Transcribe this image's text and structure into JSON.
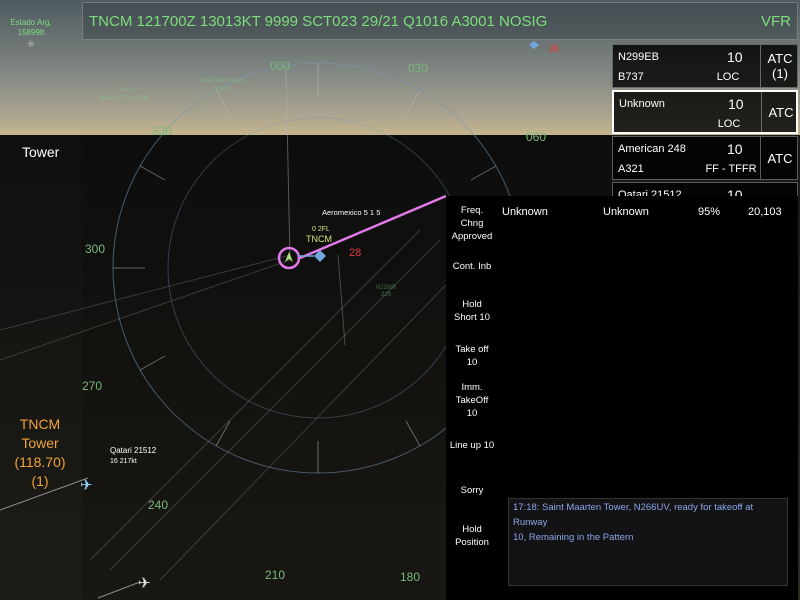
{
  "metar": {
    "text": "TNCM 121700Z 13013KT 9999 SCT023 29/21 Q1016 A3001 NOSIG",
    "rules": "VFR"
  },
  "top_left": {
    "label_line1": "Estado Arg.",
    "label_line2": "15899ft"
  },
  "left_panel": {
    "title": "Tower",
    "facility": {
      "name_line1": "TNCM",
      "name_line2": "Tower",
      "frequency": "(118.70)",
      "count": "(1)"
    }
  },
  "radar": {
    "headings": [
      "000",
      "030",
      "060",
      "300",
      "330",
      "270",
      "240",
      "210",
      "180"
    ],
    "center_label": "TNCM",
    "targets": [
      {
        "callsign": "Aeromexico 5 1 5",
        "info": "0 2FL"
      },
      {
        "callsign": "Qatari 21512",
        "info": "16 217kt"
      },
      {
        "callsign": "N239IR",
        "info": "22ft"
      },
      {
        "callsign": "GAM 848 Heavy",
        "info": "3000ft"
      },
      {
        "callsign": "Tripos",
        "info": "Boeing 777 2000ft"
      }
    ],
    "distance_marker": "28",
    "top_marker": "38"
  },
  "traffic_list": [
    {
      "name": "N299EB",
      "type": "B737",
      "altitude": "10",
      "mode": "LOC",
      "atc": "ATC",
      "atc_count": "(1)"
    },
    {
      "name": "Unknown",
      "type": "",
      "altitude": "10",
      "mode": "LOC",
      "atc": "ATC",
      "atc_count": ""
    },
    {
      "name": "American 248",
      "type": "A321",
      "altitude": "10",
      "mode": "FF - TFFR",
      "atc": "ATC",
      "atc_count": ""
    },
    {
      "name": "Qatari 21512",
      "type": "",
      "altitude": "10",
      "mode": "",
      "atc": "",
      "atc_count": ""
    }
  ],
  "commands": [
    {
      "line1": "Freq.",
      "line2": "Chng",
      "line3": "Approved"
    },
    {
      "line1": "Cont. Inb",
      "line2": "",
      "line3": ""
    },
    {
      "line1": "Hold",
      "line2": "Short 10",
      "line3": ""
    },
    {
      "line1": "Take off",
      "line2": "10",
      "line3": ""
    },
    {
      "line1": "Imm.",
      "line2": "TakeOff",
      "line3": "10"
    },
    {
      "line1": "Line up 10",
      "line2": "",
      "line3": ""
    },
    {
      "line1": "Sorry",
      "line2": "",
      "line3": ""
    },
    {
      "line1": "Hold",
      "line2": "Position",
      "line3": ""
    }
  ],
  "target_info": {
    "name": "Unknown",
    "type": "Unknown",
    "percent": "95%",
    "value": "20,103"
  },
  "log": {
    "line1": "17:18: Saint Maarten Tower, N266UV, ready for takeoff at Runway",
    "line2": "10, Remaining in the Pattern"
  },
  "colors": {
    "accent_green": "#7ddc7d",
    "freq_orange": "#f2a33a",
    "selection_magenta": "#e07ae8",
    "log_blue": "#8aa6e8"
  }
}
